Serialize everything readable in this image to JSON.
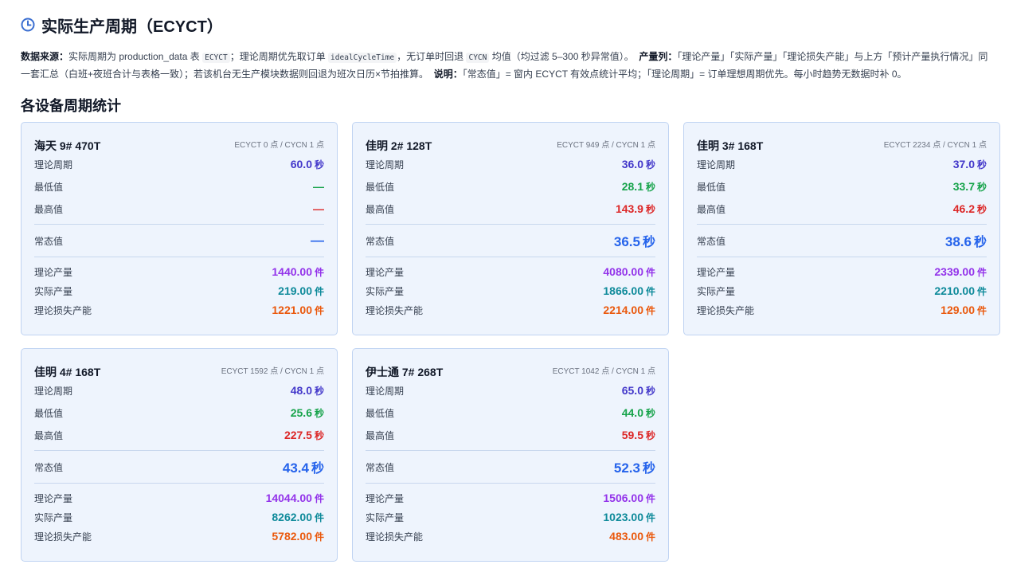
{
  "header": {
    "title": "实际生产周期（ECYCT）"
  },
  "description": {
    "source_label": "数据来源：",
    "source_1": "实际周期为 production_data 表 ",
    "code_1": "ECYCT",
    "source_2": "；理论周期优先取订单 ",
    "code_2": "idealCycleTime",
    "source_3": "，无订单时回退 ",
    "code_3": "CYCN",
    "source_4": " 均值（均过滤 5–300 秒异常值）。",
    "output_label": "产量列：",
    "output_text": "「理论产量」「实际产量」「理论损失产能」与上方「预计产量执行情况」同一套汇总（白班+夜班合计与表格一致）；若该机台无生产模块数据则回退为班次日历×节拍推算。",
    "note_label": "说明：",
    "note_text": "「常态值」= 窗内 ECYCT 有效点统计平均；「理论周期」= 订单理想周期优先。每小时趋势无数据时补 0。"
  },
  "section": {
    "title": "各设备周期统计"
  },
  "labels": {
    "theory_cycle": "理论周期",
    "min": "最低值",
    "max": "最高值",
    "normal": "常态值",
    "theory_output": "理论产量",
    "actual_output": "实际产量",
    "loss_output": "理论损失产能",
    "sec": "秒",
    "pcs": "件"
  },
  "colors": {
    "theory": "#4338ca",
    "min": "#16a34a",
    "max": "#dc2626",
    "normal": "#2563eb",
    "theory_output": "#9333ea",
    "actual_output": "#0e8a9a",
    "loss_output": "#ea580c",
    "card_bg": "#eef4fd",
    "card_border": "#bfd3f2"
  },
  "devices": [
    {
      "name": "海天 9# 470T",
      "meta": "ECYCT 0 点 / CYCN 1 点",
      "theory": "60.0",
      "min": "—",
      "max": "—",
      "normal": "—",
      "theory_output": "1440.00",
      "actual_output": "219.00",
      "loss_output": "1221.00"
    },
    {
      "name": "佳明 2# 128T",
      "meta": "ECYCT 949 点 / CYCN 1 点",
      "theory": "36.0",
      "min": "28.1",
      "max": "143.9",
      "normal": "36.5",
      "theory_output": "4080.00",
      "actual_output": "1866.00",
      "loss_output": "2214.00"
    },
    {
      "name": "佳明 3# 168T",
      "meta": "ECYCT 2234 点 / CYCN 1 点",
      "theory": "37.0",
      "min": "33.7",
      "max": "46.2",
      "normal": "38.6",
      "theory_output": "2339.00",
      "actual_output": "2210.00",
      "loss_output": "129.00"
    },
    {
      "name": "佳明 4# 168T",
      "meta": "ECYCT 1592 点 / CYCN 1 点",
      "theory": "48.0",
      "min": "25.6",
      "max": "227.5",
      "normal": "43.4",
      "theory_output": "14044.00",
      "actual_output": "8262.00",
      "loss_output": "5782.00"
    },
    {
      "name": "伊士通 7# 268T",
      "meta": "ECYCT 1042 点 / CYCN 1 点",
      "theory": "65.0",
      "min": "44.0",
      "max": "59.5",
      "normal": "52.3",
      "theory_output": "1506.00",
      "actual_output": "1023.00",
      "loss_output": "483.00"
    }
  ]
}
